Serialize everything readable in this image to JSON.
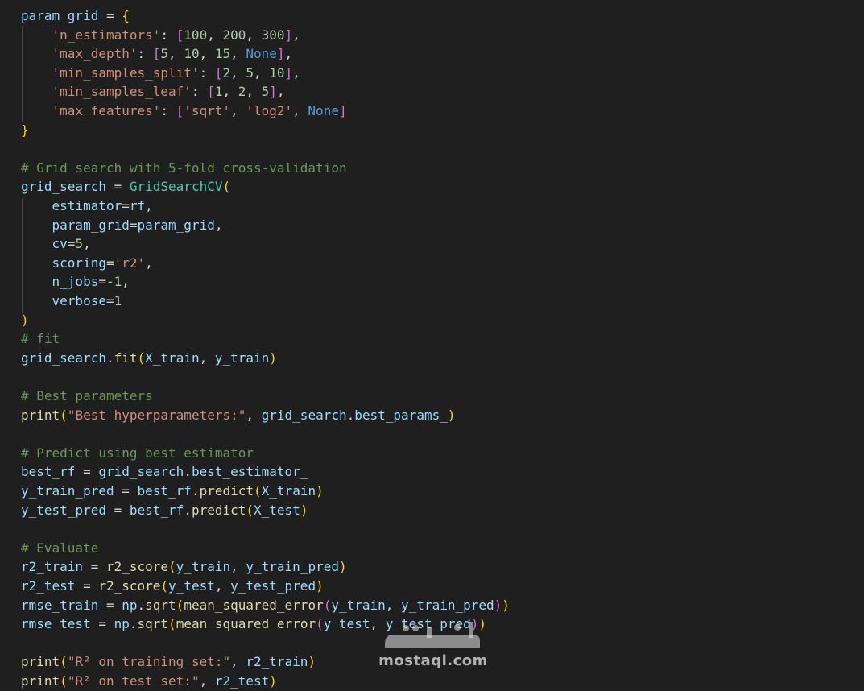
{
  "code_lines": [
    [
      [
        "param_grid",
        "var"
      ],
      [
        " = ",
        "default"
      ],
      [
        "{",
        "b1"
      ]
    ],
    [
      [
        "    ",
        "default"
      ],
      [
        "'n_estimators'",
        "str"
      ],
      [
        ": ",
        "default"
      ],
      [
        "[",
        "b2"
      ],
      [
        "100",
        "num"
      ],
      [
        ", ",
        "default"
      ],
      [
        "200",
        "num"
      ],
      [
        ", ",
        "default"
      ],
      [
        "300",
        "num"
      ],
      [
        "]",
        "b2"
      ],
      [
        ",",
        "default"
      ]
    ],
    [
      [
        "    ",
        "default"
      ],
      [
        "'max_depth'",
        "str"
      ],
      [
        ": ",
        "default"
      ],
      [
        "[",
        "b2"
      ],
      [
        "5",
        "num"
      ],
      [
        ", ",
        "default"
      ],
      [
        "10",
        "num"
      ],
      [
        ", ",
        "default"
      ],
      [
        "15",
        "num"
      ],
      [
        ", ",
        "default"
      ],
      [
        "None",
        "kw"
      ],
      [
        "]",
        "b2"
      ],
      [
        ",",
        "default"
      ]
    ],
    [
      [
        "    ",
        "default"
      ],
      [
        "'min_samples_split'",
        "str"
      ],
      [
        ": ",
        "default"
      ],
      [
        "[",
        "b2"
      ],
      [
        "2",
        "num"
      ],
      [
        ", ",
        "default"
      ],
      [
        "5",
        "num"
      ],
      [
        ", ",
        "default"
      ],
      [
        "10",
        "num"
      ],
      [
        "]",
        "b2"
      ],
      [
        ",",
        "default"
      ]
    ],
    [
      [
        "    ",
        "default"
      ],
      [
        "'min_samples_leaf'",
        "str"
      ],
      [
        ": ",
        "default"
      ],
      [
        "[",
        "b2"
      ],
      [
        "1",
        "num"
      ],
      [
        ", ",
        "default"
      ],
      [
        "2",
        "num"
      ],
      [
        ", ",
        "default"
      ],
      [
        "5",
        "num"
      ],
      [
        "]",
        "b2"
      ],
      [
        ",",
        "default"
      ]
    ],
    [
      [
        "    ",
        "default"
      ],
      [
        "'max_features'",
        "str"
      ],
      [
        ": ",
        "default"
      ],
      [
        "[",
        "b2"
      ],
      [
        "'sqrt'",
        "str"
      ],
      [
        ", ",
        "default"
      ],
      [
        "'log2'",
        "str"
      ],
      [
        ", ",
        "default"
      ],
      [
        "None",
        "kw"
      ],
      [
        "]",
        "b2"
      ]
    ],
    [
      [
        "}",
        "b1"
      ]
    ],
    [],
    [
      [
        "# Grid search with 5-fold cross-validation",
        "cmt"
      ]
    ],
    [
      [
        "grid_search",
        "var"
      ],
      [
        " = ",
        "default"
      ],
      [
        "GridSearchCV",
        "cls"
      ],
      [
        "(",
        "b1"
      ]
    ],
    [
      [
        "    ",
        "default"
      ],
      [
        "estimator",
        "var"
      ],
      [
        "=",
        "default"
      ],
      [
        "rf",
        "var"
      ],
      [
        ",",
        "default"
      ]
    ],
    [
      [
        "    ",
        "default"
      ],
      [
        "param_grid",
        "var"
      ],
      [
        "=",
        "default"
      ],
      [
        "param_grid",
        "var"
      ],
      [
        ",",
        "default"
      ]
    ],
    [
      [
        "    ",
        "default"
      ],
      [
        "cv",
        "var"
      ],
      [
        "=",
        "default"
      ],
      [
        "5",
        "num"
      ],
      [
        ",",
        "default"
      ]
    ],
    [
      [
        "    ",
        "default"
      ],
      [
        "scoring",
        "var"
      ],
      [
        "=",
        "default"
      ],
      [
        "'r2'",
        "str"
      ],
      [
        ",",
        "default"
      ]
    ],
    [
      [
        "    ",
        "default"
      ],
      [
        "n_jobs",
        "var"
      ],
      [
        "=",
        "default"
      ],
      [
        "-1",
        "num"
      ],
      [
        ",",
        "default"
      ]
    ],
    [
      [
        "    ",
        "default"
      ],
      [
        "verbose",
        "var"
      ],
      [
        "=",
        "default"
      ],
      [
        "1",
        "num"
      ]
    ],
    [
      [
        ")",
        "b1"
      ]
    ],
    [
      [
        "# fit",
        "cmt"
      ]
    ],
    [
      [
        "grid_search",
        "var"
      ],
      [
        ".",
        "default"
      ],
      [
        "fit",
        "fn"
      ],
      [
        "(",
        "b1"
      ],
      [
        "X_train",
        "var"
      ],
      [
        ", ",
        "default"
      ],
      [
        "y_train",
        "var"
      ],
      [
        ")",
        "b1"
      ]
    ],
    [],
    [
      [
        "# Best parameters",
        "cmt"
      ]
    ],
    [
      [
        "print",
        "fn"
      ],
      [
        "(",
        "b1"
      ],
      [
        "\"Best hyperparameters:\"",
        "str"
      ],
      [
        ", ",
        "default"
      ],
      [
        "grid_search",
        "var"
      ],
      [
        ".",
        "default"
      ],
      [
        "best_params_",
        "var"
      ],
      [
        ")",
        "b1"
      ]
    ],
    [],
    [
      [
        "# Predict using best estimator",
        "cmt"
      ]
    ],
    [
      [
        "best_rf",
        "var"
      ],
      [
        " = ",
        "default"
      ],
      [
        "grid_search",
        "var"
      ],
      [
        ".",
        "default"
      ],
      [
        "best_estimator_",
        "var"
      ]
    ],
    [
      [
        "y_train_pred",
        "var"
      ],
      [
        " = ",
        "default"
      ],
      [
        "best_rf",
        "var"
      ],
      [
        ".",
        "default"
      ],
      [
        "predict",
        "fn"
      ],
      [
        "(",
        "b1"
      ],
      [
        "X_train",
        "var"
      ],
      [
        ")",
        "b1"
      ]
    ],
    [
      [
        "y_test_pred",
        "var"
      ],
      [
        " = ",
        "default"
      ],
      [
        "best_rf",
        "var"
      ],
      [
        ".",
        "default"
      ],
      [
        "predict",
        "fn"
      ],
      [
        "(",
        "b1"
      ],
      [
        "X_test",
        "var"
      ],
      [
        ")",
        "b1"
      ]
    ],
    [],
    [
      [
        "# Evaluate",
        "cmt"
      ]
    ],
    [
      [
        "r2_train",
        "var"
      ],
      [
        " = ",
        "default"
      ],
      [
        "r2_score",
        "fn"
      ],
      [
        "(",
        "b1"
      ],
      [
        "y_train",
        "var"
      ],
      [
        ", ",
        "default"
      ],
      [
        "y_train_pred",
        "var"
      ],
      [
        ")",
        "b1"
      ]
    ],
    [
      [
        "r2_test",
        "var"
      ],
      [
        " = ",
        "default"
      ],
      [
        "r2_score",
        "fn"
      ],
      [
        "(",
        "b1"
      ],
      [
        "y_test",
        "var"
      ],
      [
        ", ",
        "default"
      ],
      [
        "y_test_pred",
        "var"
      ],
      [
        ")",
        "b1"
      ]
    ],
    [
      [
        "rmse_train",
        "var"
      ],
      [
        " = ",
        "default"
      ],
      [
        "np",
        "var"
      ],
      [
        ".",
        "default"
      ],
      [
        "sqrt",
        "fn"
      ],
      [
        "(",
        "b1"
      ],
      [
        "mean_squared_error",
        "fn"
      ],
      [
        "(",
        "b2"
      ],
      [
        "y_train",
        "var"
      ],
      [
        ", ",
        "default"
      ],
      [
        "y_train_pred",
        "var"
      ],
      [
        ")",
        "b2"
      ],
      [
        ")",
        "b1"
      ]
    ],
    [
      [
        "rmse_test",
        "var"
      ],
      [
        " = ",
        "default"
      ],
      [
        "np",
        "var"
      ],
      [
        ".",
        "default"
      ],
      [
        "sqrt",
        "fn"
      ],
      [
        "(",
        "b1"
      ],
      [
        "mean_squared_error",
        "fn"
      ],
      [
        "(",
        "b2"
      ],
      [
        "y_test",
        "var"
      ],
      [
        ", ",
        "default"
      ],
      [
        "y_test_pred",
        "var"
      ],
      [
        ")",
        "b2"
      ],
      [
        ")",
        "b1"
      ]
    ],
    [],
    [
      [
        "print",
        "fn"
      ],
      [
        "(",
        "b1"
      ],
      [
        "\"R² on training set:\"",
        "str"
      ],
      [
        ", ",
        "default"
      ],
      [
        "r2_train",
        "var"
      ],
      [
        ")",
        "b1"
      ]
    ],
    [
      [
        "print",
        "fn"
      ],
      [
        "(",
        "b1"
      ],
      [
        "\"R² on test set:\"",
        "str"
      ],
      [
        ", ",
        "default"
      ],
      [
        "r2_test",
        "var"
      ],
      [
        ")",
        "b1"
      ]
    ]
  ],
  "token_colors": {
    "default": "#d4d4d4",
    "var": "#9cdcfe",
    "fn": "#dcdcaa",
    "cls": "#4ec9b0",
    "str": "#ce9178",
    "num": "#b5cea8",
    "kw": "#569cd6",
    "cmt": "#6a9955",
    "b1": "#ffd700",
    "b2": "#da70d6",
    "b3": "#179fff"
  },
  "background_color": "#1f1f1f",
  "watermark": {
    "logo_text": "مستقل",
    "site_text": "mostaql.com"
  }
}
